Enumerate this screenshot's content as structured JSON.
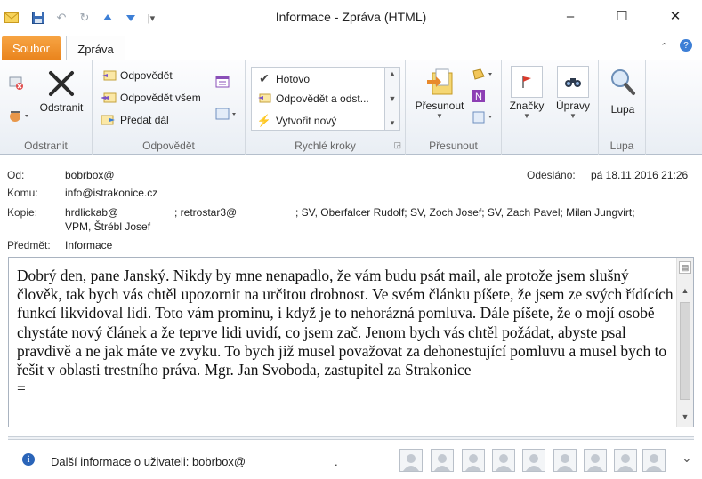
{
  "window": {
    "title": "Informace  -  Zpráva (HTML)",
    "minimize_icon": "–",
    "maximize_icon": "☐",
    "close_icon": "✕"
  },
  "ribbon_tabs": {
    "file": "Soubor",
    "message": "Zpráva"
  },
  "ribbon": {
    "delete_group": {
      "label": "Odstranit",
      "delete_button": "Odstranit"
    },
    "respond_group": {
      "label": "Odpovědět",
      "reply": "Odpovědět",
      "reply_all": "Odpovědět všem",
      "forward": "Předat dál"
    },
    "quick_steps_group": {
      "label": "Rychlé kroky",
      "items": [
        "Hotovo",
        "Odpovědět a odst...",
        "Vytvořit nový"
      ]
    },
    "move_group": {
      "label": "Přesunout",
      "move_button": "Přesunout"
    },
    "tags_button": "Značky",
    "editing_button": "Úpravy",
    "zoom_group": {
      "label": "Lupa",
      "zoom_button": "Lupa"
    }
  },
  "header": {
    "from_label": "Od:",
    "from_value": "bobrbox@",
    "to_label": "Komu:",
    "to_value": "info@istrakonice.cz",
    "cc_label": "Kopie:",
    "cc_part1": "hrdlickab@",
    "cc_part2": "; retrostar3@",
    "cc_part3": "; SV, Oberfalcer Rudolf; SV, Zoch Josef; SV, Zach Pavel; Milan Jungvirt;",
    "cc_line2": "VPM, Štrébl Josef",
    "subject_label": "Předmět:",
    "subject_value": "Informace",
    "sent_label": "Odesláno:",
    "sent_value": "pá 18.11.2016 21:26"
  },
  "message_body": {
    "text": "Dobrý den, pane Janský. Nikdy by mne nenapadlo, že vám budu psát mail, ale protože jsem slušný člověk, tak bych vás chtěl upozornit na určitou drobnost. Ve svém článku píšete, že jsem ze svých řídících funkcí likvidoval lidi. Toto vám prominu, i když je to nehorázná pomluva. Dále píšete, že o mojí osobě chystáte nový článek a že teprve lidi uvidí, co jsem zač. Jenom bych vás chtěl požádat, abyste psal pravdivě a ne jak máte ve zvyku. To bych již musel považovat za dehonestující pomluvu a musel bych to řešit v oblasti trestního práva.   Mgr. Jan Svoboda, zastupitel za Strakonice",
    "trailing": "="
  },
  "people_pane": {
    "info_text": "Další informace o uživateli: bobrbox@",
    "trailing_dot": ".",
    "collapse_icon": "⌄"
  }
}
